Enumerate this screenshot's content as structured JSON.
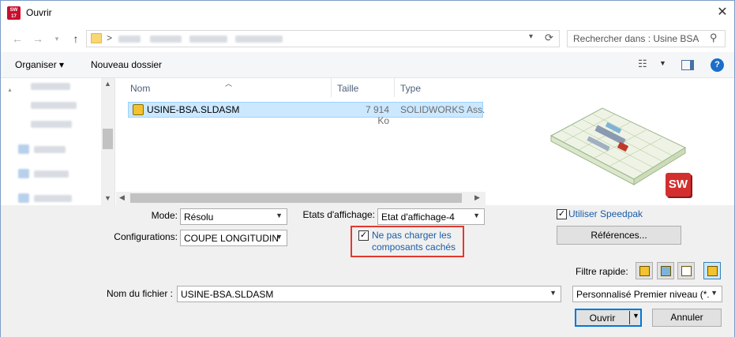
{
  "window": {
    "title": "Ouvrir",
    "app_icon_text": "SW 2017"
  },
  "nav": {
    "back_icon": "back-arrow-icon",
    "forward_icon": "forward-arrow-icon",
    "recent_icon": "chevron-down-icon",
    "up_icon": "up-arrow-icon",
    "address_breadcrumb_separator": ">",
    "search_placeholder": "Rechercher dans : Usine BSA"
  },
  "toolbar": {
    "organize_label": "Organiser ▾",
    "new_folder_label": "Nouveau dossier"
  },
  "file_list": {
    "columns": [
      "Nom",
      "Taille",
      "Type"
    ],
    "rows": [
      {
        "name": "USINE-BSA.SLDASM",
        "size": "7 914 Ko",
        "type": "SOLIDWORKS Ass..."
      }
    ]
  },
  "options": {
    "mode_label": "Mode:",
    "mode_value": "Résolu",
    "configurations_label": "Configurations:",
    "configurations_value": "COUPE LONGITUDIN",
    "display_states_label": "Etats d'affichage:",
    "display_states_value": "Etat d'affichage-4",
    "hide_components_label_line1": "Ne pas charger les",
    "hide_components_label_line2": "composants cachés",
    "hide_components_checked": true,
    "speedpak_label": "Utiliser Speedpak",
    "speedpak_checked": true,
    "references_button": "Références...",
    "quick_filter_label": "Filtre rapide:"
  },
  "filename": {
    "label": "Nom du fichier :",
    "value": "USINE-BSA.SLDASM",
    "filetype_value": "Personnalisé Premier niveau (*."
  },
  "buttons": {
    "open": "Ouvrir",
    "cancel": "Annuler"
  },
  "colors": {
    "accent_link": "#1a5ca8",
    "selection_bg": "#cce8ff",
    "highlight_border": "#e2392f"
  }
}
